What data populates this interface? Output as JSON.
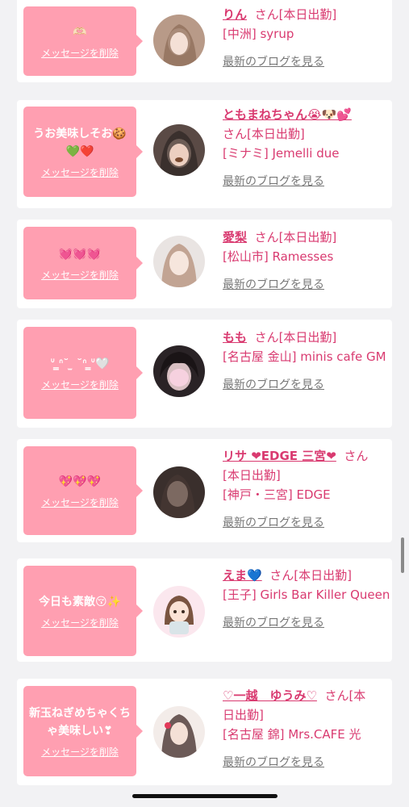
{
  "delete_label": "メッセージを削除",
  "blog_label": "最新のブログを見る",
  "san": "さん",
  "status": "[本日出勤]",
  "cards": [
    {
      "message": "🫶🏻",
      "name": "りん",
      "line1": "さん[本日出勤]",
      "shop": "[中洲] syrup"
    },
    {
      "message": "うお美味しそお🍪💚❤️",
      "name": "ともまねちゃん😭🐶💕",
      "line1": "さん[本日出勤]",
      "shop": "[ミナミ] Jemelli due"
    },
    {
      "message": "💓💓💓",
      "name": "愛梨",
      "line1": "さん[本日出勤]",
      "shop": "[松山市] Ramesses"
    },
    {
      "message": "ᐡ ̳ᐢ˘ ̫ ˘ᐢ ̳ᐡ🤍",
      "name": "もも",
      "line1": "さん[本日出勤]",
      "shop": "[名古屋 金山] minis cafe GM"
    },
    {
      "message": "💖💖💖",
      "name": "リサ ❤EDGE 三宮❤",
      "line1": "さん",
      "line2": "[本日出勤]",
      "shop": "[神戸・三宮] EDGE"
    },
    {
      "message": "今日も素敵😚✨",
      "name": "えま💙",
      "line1": "さん[本日出勤]",
      "shop": "[王子] Girls Bar Killer Queen"
    },
    {
      "message": "新玉ねぎめちゃくちゃ美味しい❣",
      "name": "♡一越　ゆうみ♡",
      "line1": "さん[本",
      "line2": "日出勤]",
      "shop": "[名古屋 錦] Mrs.CAFE 光"
    }
  ],
  "colors": {
    "accent": "#d93a70",
    "bubble": "#ff9fb1",
    "background": "#f2f2f4"
  }
}
